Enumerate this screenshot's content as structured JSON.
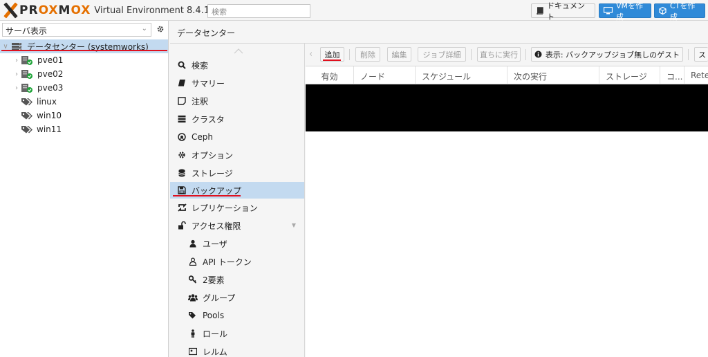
{
  "header": {
    "brand": "PROXMOX",
    "brand_sub": "Virtual Environment",
    "version": "8.4.1",
    "search_placeholder": "検索",
    "docs_label": "ドキュメント",
    "create_vm_label": "VMを作成",
    "create_ct_label": "CTを作成"
  },
  "tree": {
    "view_select": "サーバ表示",
    "root": "データセンター (systemworks)",
    "nodes": [
      "pve01",
      "pve02",
      "pve03"
    ],
    "tags": [
      "linux",
      "win10",
      "win11"
    ]
  },
  "content": {
    "title": "データセンター"
  },
  "nav": {
    "items": [
      {
        "label": "検索",
        "icon": "search-icon"
      },
      {
        "label": "サマリー",
        "icon": "book-icon"
      },
      {
        "label": "注釈",
        "icon": "note-icon"
      },
      {
        "label": "クラスタ",
        "icon": "server-icon"
      },
      {
        "label": "Ceph",
        "icon": "ceph-icon"
      },
      {
        "label": "オプション",
        "icon": "gear-icon"
      },
      {
        "label": "ストレージ",
        "icon": "database-icon"
      },
      {
        "label": "バックアップ",
        "icon": "floppy-icon"
      },
      {
        "label": "レプリケーション",
        "icon": "retweet-icon"
      },
      {
        "label": "アクセス権限",
        "icon": "unlock-icon"
      },
      {
        "label": "ユーザ",
        "icon": "user-icon"
      },
      {
        "label": "API トークン",
        "icon": "user-outline-icon"
      },
      {
        "label": "2要素",
        "icon": "key-icon"
      },
      {
        "label": "グループ",
        "icon": "users-icon"
      },
      {
        "label": "Pools",
        "icon": "tags-icon"
      },
      {
        "label": "ロール",
        "icon": "male-icon"
      },
      {
        "label": "レルム",
        "icon": "address-card-icon"
      }
    ]
  },
  "toolbar": {
    "add": "追加",
    "delete": "削除",
    "edit": "編集",
    "job_detail": "ジョブ詳細",
    "run_now": "直ちに実行",
    "show_guests": "表示: バックアップジョブ無しのゲスト",
    "more": "ス"
  },
  "grid": {
    "columns": [
      "有効",
      "ノード",
      "スケジュール",
      "次の実行",
      "ストレージ",
      "コ...",
      "Rete"
    ]
  },
  "colors": {
    "accent": "#2f8ad8",
    "selection": "#c3daf0",
    "brand_orange": "#e57000",
    "highlight_red": "#e0101e"
  }
}
